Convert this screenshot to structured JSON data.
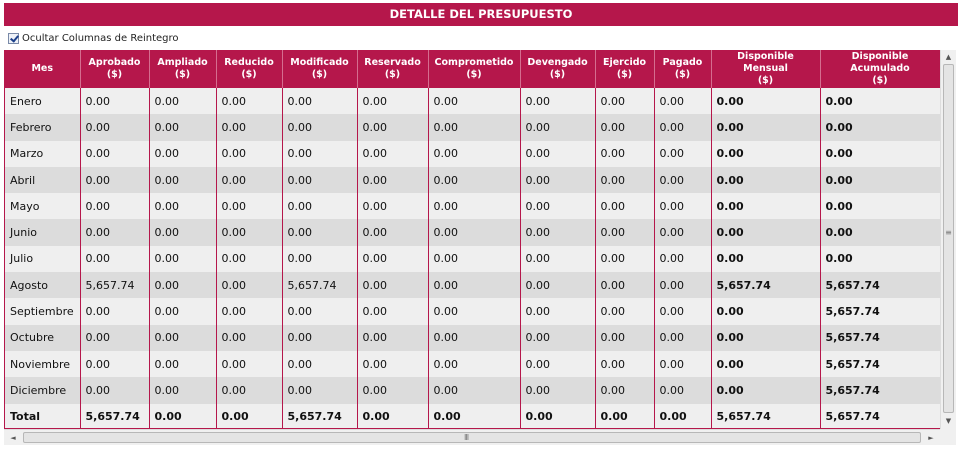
{
  "title": "DETALLE DEL PRESUPUESTO",
  "hide_refund_columns": {
    "label": "Ocultar Columnas de Reintegro",
    "checked": true
  },
  "columns": [
    {
      "line1": "Mes",
      "line2": ""
    },
    {
      "line1": "Aprobado",
      "line2": "($)"
    },
    {
      "line1": "Ampliado",
      "line2": "($)"
    },
    {
      "line1": "Reducido",
      "line2": "($)"
    },
    {
      "line1": "Modificado",
      "line2": "($)"
    },
    {
      "line1": "Reservado",
      "line2": "($)"
    },
    {
      "line1": "Comprometido",
      "line2": "($)"
    },
    {
      "line1": "Devengado",
      "line2": "($)"
    },
    {
      "line1": "Ejercido",
      "line2": "($)"
    },
    {
      "line1": "Pagado",
      "line2": "($)"
    },
    {
      "line1": "Disponible Mensual",
      "line2": "($)"
    },
    {
      "line1": "Disponible Acumulado",
      "line2": "($)"
    }
  ],
  "rows": [
    [
      "Enero",
      "0.00",
      "0.00",
      "0.00",
      "0.00",
      "0.00",
      "0.00",
      "0.00",
      "0.00",
      "0.00",
      "0.00",
      "0.00"
    ],
    [
      "Febrero",
      "0.00",
      "0.00",
      "0.00",
      "0.00",
      "0.00",
      "0.00",
      "0.00",
      "0.00",
      "0.00",
      "0.00",
      "0.00"
    ],
    [
      "Marzo",
      "0.00",
      "0.00",
      "0.00",
      "0.00",
      "0.00",
      "0.00",
      "0.00",
      "0.00",
      "0.00",
      "0.00",
      "0.00"
    ],
    [
      "Abril",
      "0.00",
      "0.00",
      "0.00",
      "0.00",
      "0.00",
      "0.00",
      "0.00",
      "0.00",
      "0.00",
      "0.00",
      "0.00"
    ],
    [
      "Mayo",
      "0.00",
      "0.00",
      "0.00",
      "0.00",
      "0.00",
      "0.00",
      "0.00",
      "0.00",
      "0.00",
      "0.00",
      "0.00"
    ],
    [
      "Junio",
      "0.00",
      "0.00",
      "0.00",
      "0.00",
      "0.00",
      "0.00",
      "0.00",
      "0.00",
      "0.00",
      "0.00",
      "0.00"
    ],
    [
      "Julio",
      "0.00",
      "0.00",
      "0.00",
      "0.00",
      "0.00",
      "0.00",
      "0.00",
      "0.00",
      "0.00",
      "0.00",
      "0.00"
    ],
    [
      "Agosto",
      "5,657.74",
      "0.00",
      "0.00",
      "5,657.74",
      "0.00",
      "0.00",
      "0.00",
      "0.00",
      "0.00",
      "5,657.74",
      "5,657.74"
    ],
    [
      "Septiembre",
      "0.00",
      "0.00",
      "0.00",
      "0.00",
      "0.00",
      "0.00",
      "0.00",
      "0.00",
      "0.00",
      "0.00",
      "5,657.74"
    ],
    [
      "Octubre",
      "0.00",
      "0.00",
      "0.00",
      "0.00",
      "0.00",
      "0.00",
      "0.00",
      "0.00",
      "0.00",
      "0.00",
      "5,657.74"
    ],
    [
      "Noviembre",
      "0.00",
      "0.00",
      "0.00",
      "0.00",
      "0.00",
      "0.00",
      "0.00",
      "0.00",
      "0.00",
      "0.00",
      "5,657.74"
    ],
    [
      "Diciembre",
      "0.00",
      "0.00",
      "0.00",
      "0.00",
      "0.00",
      "0.00",
      "0.00",
      "0.00",
      "0.00",
      "0.00",
      "5,657.74"
    ]
  ],
  "total_row": [
    "Total",
    "5,657.74",
    "0.00",
    "0.00",
    "5,657.74",
    "0.00",
    "0.00",
    "0.00",
    "0.00",
    "0.00",
    "5,657.74",
    "5,657.74"
  ],
  "colors": {
    "header_bg": "#b5174b",
    "row_light": "#efefef",
    "row_dark": "#dcdcdc"
  },
  "icons": {
    "up": "scroll-up-arrow-icon",
    "down": "scroll-down-arrow-icon",
    "left": "scroll-left-arrow-icon",
    "right": "scroll-right-arrow-icon"
  },
  "scroll_glyphs": {
    "up": "▲",
    "down": "▼",
    "left": "◄",
    "right": "►",
    "v_grip": "≡",
    "h_grip": "III"
  }
}
